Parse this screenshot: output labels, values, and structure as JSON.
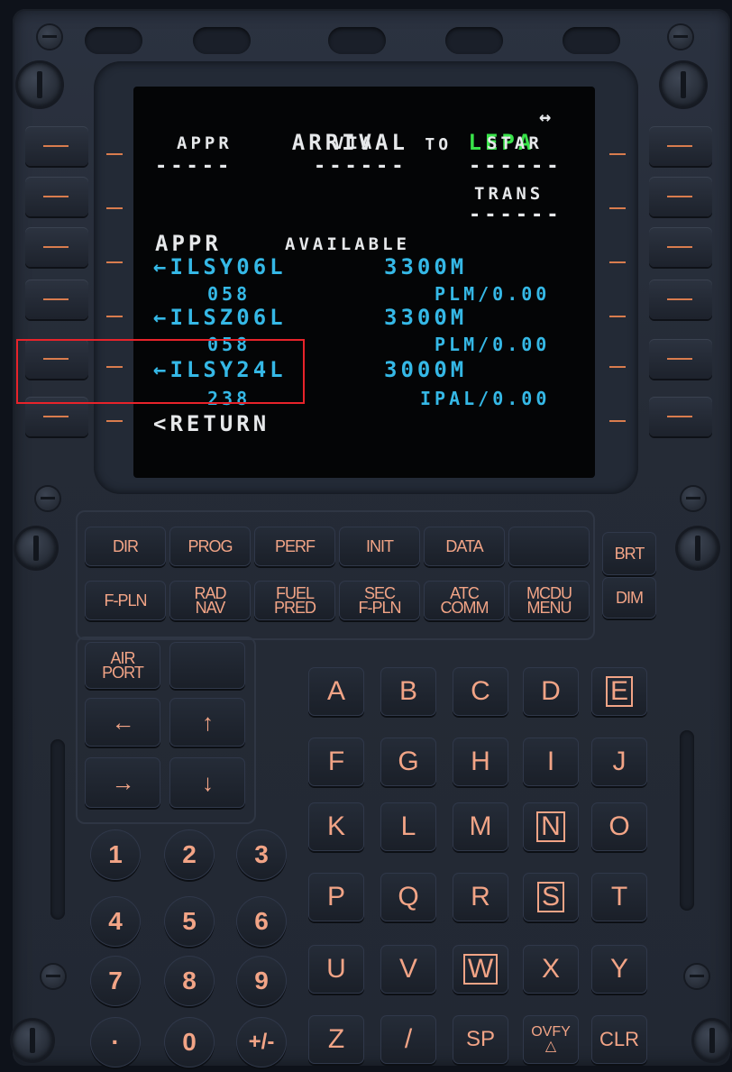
{
  "screen": {
    "title_prefix": "ARRIVAL ",
    "title_to": "TO",
    "title_airport": "LEPA",
    "title_arrows": "↔",
    "headers": {
      "appr": "APPR",
      "via": "VIA",
      "star": "STAR",
      "trans": "TRANS"
    },
    "dashes": {
      "appr": "-----",
      "via": "------",
      "star": "------",
      "trans": "------"
    },
    "section_label": "APPR",
    "section_available": "AVAILABLE",
    "approaches": [
      {
        "name": "←ILSY06L",
        "length": "3300M",
        "course": "058",
        "via": "PLM/0.00"
      },
      {
        "name": "←ILSZ06L",
        "length": "3300M",
        "course": "058",
        "via": "PLM/0.00"
      },
      {
        "name": "←ILSY24L",
        "length": "3000M",
        "course": "238",
        "via": "IPAL/0.00"
      }
    ],
    "return": "<RETURN"
  },
  "function_keys": {
    "row1": [
      "DIR",
      "PROG",
      "PERF",
      "INIT",
      "DATA",
      ""
    ],
    "row2": [
      "F-PLN",
      "RAD\nNAV",
      "FUEL\nPRED",
      "SEC\nF-PLN",
      "ATC\nCOMM",
      "MCDU\nMENU"
    ],
    "brt": "BRT",
    "dim": "DIM",
    "airport": "AIR\nPORT",
    "arrow_left": "←",
    "arrow_right": "→",
    "arrow_up": "↑",
    "arrow_down": "↓"
  },
  "alpha_keys": [
    "A",
    "B",
    "C",
    "D",
    "E",
    "F",
    "G",
    "H",
    "I",
    "J",
    "K",
    "L",
    "M",
    "N",
    "O",
    "P",
    "Q",
    "R",
    "S",
    "T",
    "U",
    "V",
    "W",
    "X",
    "Y",
    "Z",
    "/",
    "SP",
    "OVFY\n△",
    "CLR"
  ],
  "numeric_keys": [
    "1",
    "2",
    "3",
    "4",
    "5",
    "6",
    "7",
    "8",
    "9",
    "·",
    "0",
    "+/-"
  ],
  "colors": {
    "cyan": "#35b8e6",
    "white": "#e6e8ea",
    "green": "#39e34a",
    "key_text": "#f2a486",
    "lsk_dash": "#d97c4e",
    "highlight": "#e8232a"
  }
}
